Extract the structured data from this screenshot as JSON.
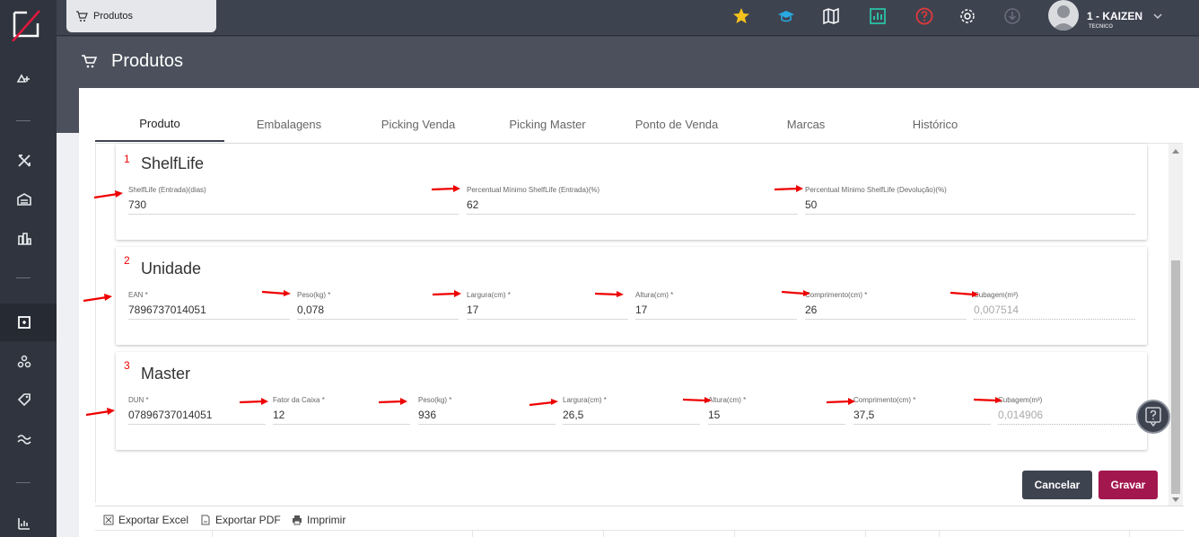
{
  "topbar": {
    "tab_label": "Produtos",
    "user_name": "1 - KAIZEN",
    "user_role": "TECNICO"
  },
  "header": {
    "title": "Produtos"
  },
  "tabs": [
    {
      "label": "Produto",
      "active": true
    },
    {
      "label": "Embalagens"
    },
    {
      "label": "Picking Venda"
    },
    {
      "label": "Picking Master"
    },
    {
      "label": "Ponto de Venda"
    },
    {
      "label": "Marcas"
    },
    {
      "label": "Histórico"
    }
  ],
  "sections": {
    "shelflife": {
      "number": "1",
      "title": "ShelfLife",
      "fields": [
        {
          "label": "ShelfLife (Entrada)(dias)",
          "value": "730"
        },
        {
          "label": "Percentual Mínimo ShelfLife (Entrada)(%)",
          "value": "62"
        },
        {
          "label": "Percentual Mínimo ShelfLife (Devolução)(%)",
          "value": "50"
        }
      ]
    },
    "unidade": {
      "number": "2",
      "title": "Unidade",
      "fields": [
        {
          "label": "EAN *",
          "value": "7896737014051"
        },
        {
          "label": "Peso(kg) *",
          "value": "0,078"
        },
        {
          "label": "Largura(cm) *",
          "value": "17"
        },
        {
          "label": "Altura(cm) *",
          "value": "17"
        },
        {
          "label": "Comprimento(cm) *",
          "value": "26"
        },
        {
          "label": "Cubagem(m³)",
          "value": "0,007514"
        }
      ]
    },
    "master": {
      "number": "3",
      "title": "Master",
      "fields": [
        {
          "label": "DUN *",
          "value": "07896737014051"
        },
        {
          "label": "Fator da Caixa *",
          "value": "12"
        },
        {
          "label": "Peso(kg) *",
          "value": "936"
        },
        {
          "label": "Largura(cm) *",
          "value": "26,5"
        },
        {
          "label": "Altura(cm) *",
          "value": "15"
        },
        {
          "label": "Comprimento(cm) *",
          "value": "37,5"
        },
        {
          "label": "Cubagem(m³)",
          "value": "0,014906"
        }
      ]
    }
  },
  "buttons": {
    "cancel": "Cancelar",
    "save": "Gravar"
  },
  "footer": {
    "export_excel": "Exportar Excel",
    "export_pdf": "Exportar PDF",
    "print": "Imprimir"
  },
  "colors": {
    "accent": "#a3174f",
    "dark": "#3e4350",
    "annotation": "#e00000"
  },
  "icons": {
    "topbar": [
      "star-icon",
      "graduation-cap-icon",
      "map-icon",
      "chart-icon",
      "help-icon",
      "gear-icon",
      "download-icon"
    ],
    "sidebar": [
      "logo-icon",
      "scale-icon",
      "tools-icon",
      "warehouse-icon",
      "buildings-icon",
      "product-icon",
      "boxes-icon",
      "tag-icon",
      "flow-icon",
      "report-icon"
    ]
  }
}
